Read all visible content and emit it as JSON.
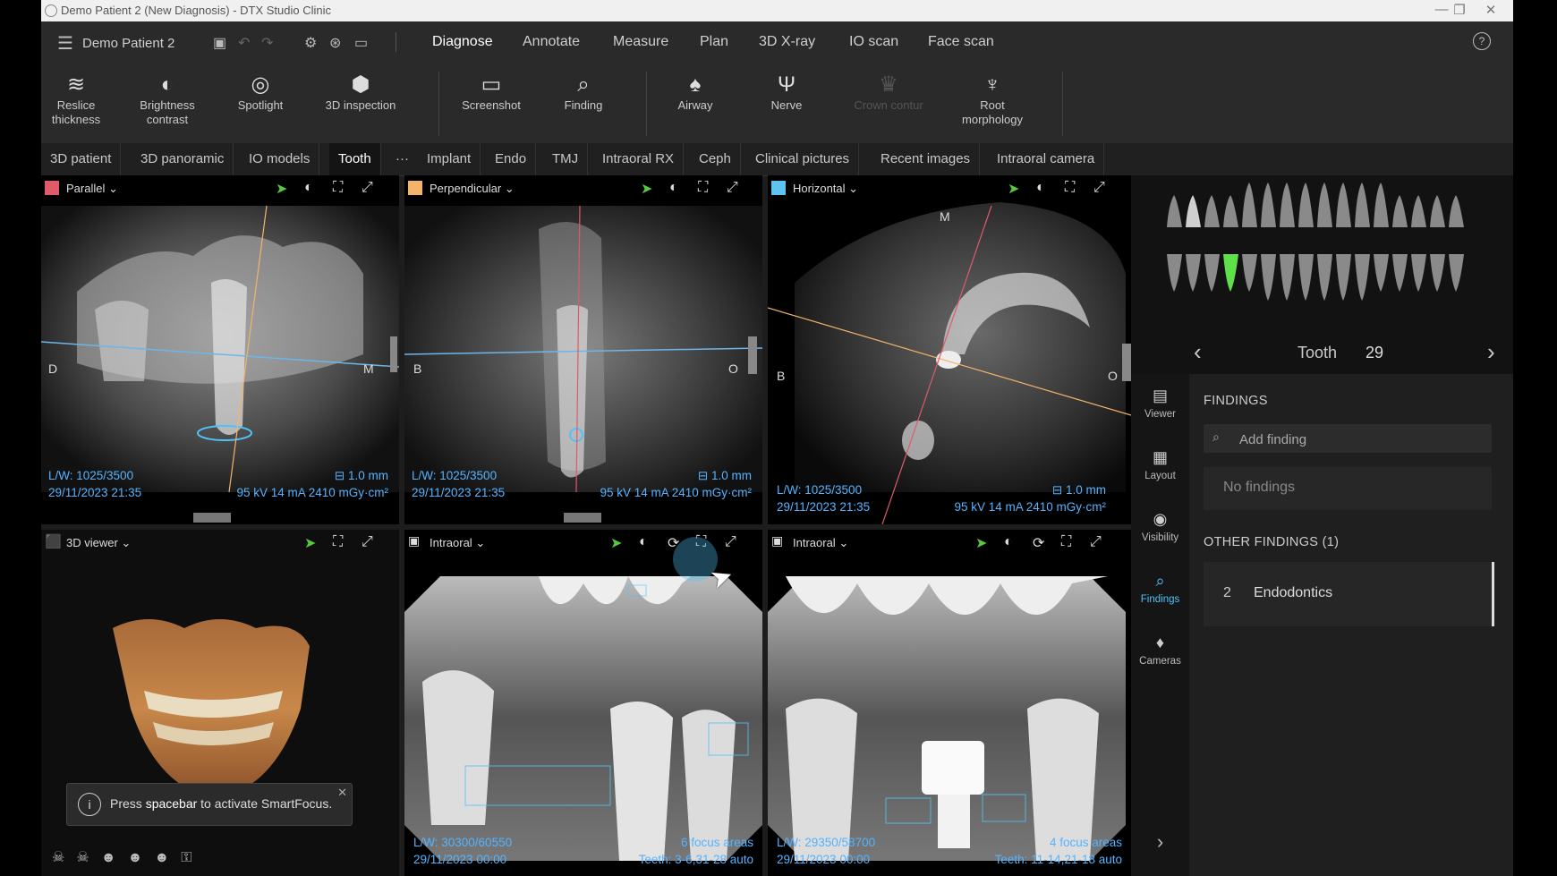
{
  "window": {
    "title": "Demo Patient 2 (New Diagnosis) - DTX Studio Clinic",
    "minimize": "—",
    "maximize": "❐",
    "close": "✕"
  },
  "menubar": {
    "patient": "Demo Patient 2",
    "modes": [
      "Diagnose",
      "Annotate",
      "Measure",
      "Plan",
      "3D X-ray",
      "IO scan",
      "Face scan"
    ],
    "active_mode": "Diagnose"
  },
  "toolbar": {
    "tools": [
      {
        "label": "Reslice\nthickness",
        "icon": "layers-icon",
        "glyph": "≋"
      },
      {
        "label": "Brightness\ncontrast",
        "icon": "contrast-icon",
        "glyph": "◐"
      },
      {
        "label": "Spotlight",
        "icon": "spotlight-icon",
        "glyph": "◎"
      },
      {
        "label": "3D inspection",
        "icon": "3d-inspection-icon",
        "glyph": "⬢"
      },
      {
        "label": "Screenshot",
        "icon": "screenshot-icon",
        "glyph": "▭"
      },
      {
        "label": "Finding",
        "icon": "finding-icon",
        "glyph": "⌕"
      },
      {
        "label": "Airway",
        "icon": "airway-icon",
        "glyph": "♠"
      },
      {
        "label": "Nerve",
        "icon": "nerve-icon",
        "glyph": "Ψ"
      },
      {
        "label": "Crown contur",
        "icon": "crown-icon",
        "glyph": "♛"
      },
      {
        "label": "Root\nmorphology",
        "icon": "root-icon",
        "glyph": "♆"
      }
    ]
  },
  "tabs": [
    "3D patient",
    "3D panoramic",
    "IO models",
    "Tooth",
    "···",
    "Implant",
    "Endo",
    "TMJ",
    "Intraoral RX",
    "Ceph",
    "Clinical pictures",
    "Recent images",
    "Intraoral camera"
  ],
  "active_tab": "Tooth",
  "viewports": {
    "parallel": {
      "label": "Parallel",
      "color": "#e05a6a",
      "lw": "L/W: 1025/3500",
      "date": "29/11/2023 21:35",
      "thickness": "1.0 mm",
      "exposure": "95 kV  14 mA  2410 mGy·cm²",
      "left": "D",
      "right": "M"
    },
    "perpendicular": {
      "label": "Perpendicular",
      "color": "#f2b36c",
      "lw": "L/W: 1025/3500",
      "date": "29/11/2023 21:35",
      "thickness": "1.0 mm",
      "exposure": "95 kV  14 mA  2410 mGy·cm²",
      "left": "B",
      "right": "O"
    },
    "horizontal": {
      "label": "Horizontal",
      "color": "#5fc3f0",
      "lw": "L/W: 1025/3500",
      "date": "29/11/2023 21:35",
      "thickness": "1.0 mm",
      "exposure": "95 kV  14 mA  2410 mGy·cm²",
      "left": "B",
      "right": "O",
      "top": "M"
    },
    "viewer3d": {
      "label": "3D viewer"
    },
    "intraoral1": {
      "label": "Intraoral",
      "lw": "L/W: 30300/60550",
      "date": "29/11/2023 00:00",
      "areas": "6 focus areas",
      "teeth": "Teeth: 3-6,31-28 auto"
    },
    "intraoral2": {
      "label": "Intraoral",
      "lw": "L/W: 29350/58700",
      "date": "29/11/2023 00:00",
      "areas": "4 focus areas",
      "teeth": "Teeth: 11-14,21-18 auto"
    }
  },
  "toast": {
    "pre": "Press ",
    "key": "spacebar",
    "post": " to activate SmartFocus.",
    "close": "✕"
  },
  "tooth_nav": {
    "label": "Tooth",
    "number": "29",
    "prev": "‹",
    "next": "›"
  },
  "sidebar": {
    "items": [
      {
        "label": "Viewer",
        "icon": "viewer-icon",
        "glyph": "▤"
      },
      {
        "label": "Layout",
        "icon": "layout-icon",
        "glyph": "▦"
      },
      {
        "label": "Visibility",
        "icon": "eye-icon",
        "glyph": "◉"
      },
      {
        "label": "Findings",
        "icon": "findings-icon",
        "glyph": "⌕"
      },
      {
        "label": "Cameras",
        "icon": "camera-icon",
        "glyph": "♦"
      }
    ],
    "active": "Findings",
    "expand": "›"
  },
  "findings": {
    "title": "FINDINGS",
    "search_placeholder": "Add finding",
    "empty": "No findings",
    "other_title": "OTHER FINDINGS (1)",
    "other": [
      {
        "num": "2",
        "name": "Endodontics"
      }
    ]
  },
  "accent": "#4fc3f7",
  "cursor_color": "#59c93f"
}
